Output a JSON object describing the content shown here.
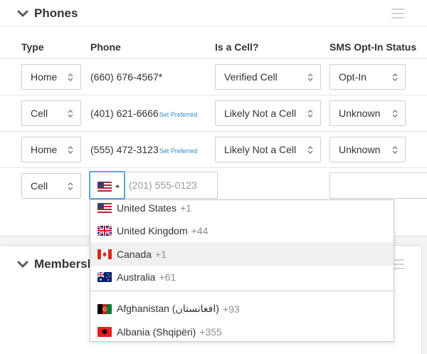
{
  "phones_panel": {
    "title": "Phones",
    "columns": {
      "type": "Type",
      "phone": "Phone",
      "is_cell": "Is a Cell?",
      "sms": "SMS Opt-In Status"
    },
    "rows": [
      {
        "type": "Home",
        "phone": "(660) 676-4567*",
        "set_preferred": "",
        "cell": "Verified Cell",
        "sms": "Opt-In"
      },
      {
        "type": "Cell",
        "phone": "(401) 621-6666",
        "set_preferred": "Set Preferred",
        "cell": "Likely Not a Cell",
        "sms": "Unknown"
      },
      {
        "type": "Home",
        "phone": "(555) 472-3123",
        "set_preferred": "Set Preferred",
        "cell": "Likely Not a Cell",
        "sms": "Unknown"
      }
    ],
    "new_row": {
      "type": "Cell",
      "phone_placeholder": "(201) 555-0123",
      "selected_flag": "us-flag"
    }
  },
  "country_dropdown": {
    "items": [
      {
        "name": "United States",
        "code": "+1",
        "flag": "us-flag"
      },
      {
        "name": "United Kingdom",
        "code": "+44",
        "flag": "uk-flag"
      },
      {
        "name": "Canada",
        "code": "+1",
        "flag": "canada-flag",
        "highlighted": true
      },
      {
        "name": "Australia",
        "code": "+61",
        "flag": "australia-flag"
      },
      {
        "name": "Afghanistan (‫افغانستان‬‎)",
        "code": "+93",
        "flag": "afghanistan-flag"
      },
      {
        "name": "Albania (Shqipëri)",
        "code": "+355",
        "flag": "albania-flag"
      }
    ]
  },
  "memberships_panel": {
    "title": "Membersh"
  },
  "colors": {
    "link": "#2e8bd0",
    "focus": "#5ea3d8",
    "border": "#cfcfcf",
    "highlight": "#f0f0f0"
  }
}
